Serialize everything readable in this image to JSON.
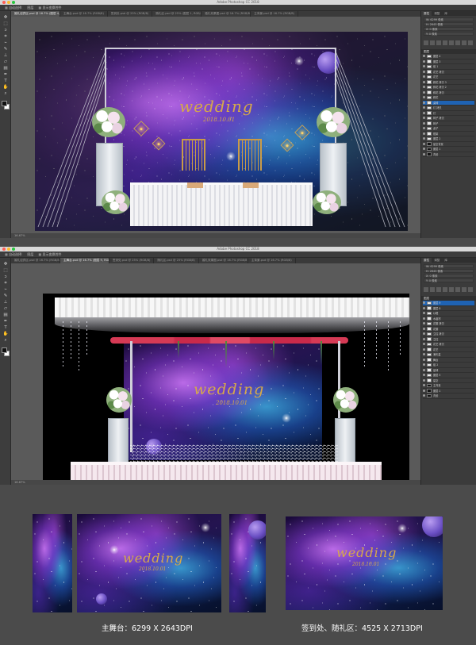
{
  "app_title": "Adobe Photoshop CC 2018",
  "window1": {
    "tabs": [
      "婚礼迎宾区.psd @ 16.7% (图层 4, RGB/8)",
      "主舞台.psd @ 16.7% (RGB/8)",
      "签到处.psd @ 25% (RGB/8)",
      "随礼区.psd @ 25% (图层 1, RGB/8)",
      "婚礼效果图.psd @ 16.7% (RGB/8)",
      "主背景.psd @ 16.7% (RGB/8)"
    ],
    "active_tab": 0,
    "status": "16.67%",
    "wedding_text": "wedding",
    "date_text": "2018.10.01",
    "layers": [
      "图层 4",
      "图层 3",
      "组 1",
      "花艺 拷贝",
      "花艺",
      "鲜花 拷贝 3",
      "鲜花 拷贝 2",
      "鲜花 拷贝",
      "鲜花",
      "桌椅",
      "灯 拷贝",
      "灯",
      "椅子 拷贝",
      "椅子",
      "桌子",
      "框架",
      "图层 2",
      "星空背景",
      "图层 1",
      "背景"
    ],
    "selected_layer": 9
  },
  "window2": {
    "tabs": [
      "婚礼迎宾区.psd @ 16.7% (RGB/8)",
      "主舞台.psd @ 16.7% (图层 9, RGB/8)",
      "签到处.psd @ 25% (RGB/8)",
      "随礼区.psd @ 25% (RGB/8)",
      "婚礼效果图.psd @ 16.7% (RGB/8)",
      "主背景.psd @ 16.7% (RGB/8)"
    ],
    "active_tab": 1,
    "status": "16.67%",
    "wedding_text": "wedding",
    "date_text": "2018.10.01",
    "layers": [
      "图层 9",
      "图层 8",
      "纱幔",
      "水晶帘",
      "花藤 拷贝",
      "花藤",
      "立柱 拷贝",
      "立柱",
      "花艺 拷贝",
      "花艺",
      "满天星",
      "舞台",
      "组 2",
      "星球",
      "图层 5",
      "星空",
      "主背景",
      "图层 1",
      "背景"
    ],
    "selected_layer": 0
  },
  "panels": {
    "tabs": [
      "属性",
      "调整",
      "库"
    ],
    "props": [
      "W: 6299 像素",
      "H: 2643 像素",
      "X: 0 像素",
      "Y: 0 像素"
    ],
    "layers_header": "图层"
  },
  "options_bar": [
    "自动选择:",
    "图层",
    "显示变换控件"
  ],
  "preview_wedding": "wedding",
  "preview_date": "2018.10.01",
  "captions": {
    "left": "主舞台：6299 X 2643DPI",
    "right": "签到处、随礼区：4525 X 2713DPI"
  },
  "colors": {
    "app_bg": "#4b4b4b",
    "gold_text": "#d6a94a",
    "selected_layer": "#1f63b4"
  },
  "icons": [
    "move-tool-icon",
    "marquee-tool-icon",
    "lasso-tool-icon",
    "crop-tool-icon",
    "eyedropper-icon",
    "brush-icon",
    "stamp-icon",
    "eraser-icon",
    "gradient-icon",
    "pen-icon",
    "type-icon",
    "hand-icon",
    "zoom-icon"
  ]
}
